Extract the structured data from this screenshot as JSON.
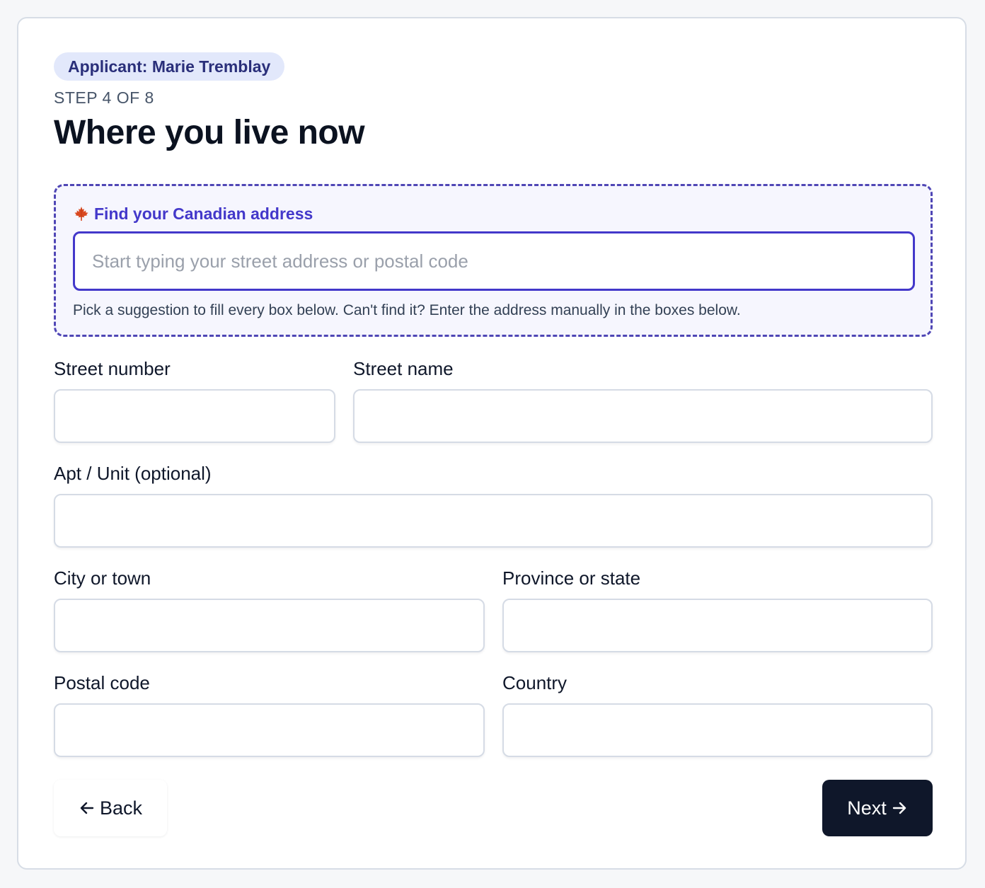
{
  "header": {
    "applicant_badge": "Applicant: Marie Tremblay",
    "step": "STEP 4 OF 8",
    "title": "Where you live now"
  },
  "lookup": {
    "heading": "Find your Canadian address",
    "icon": "maple-leaf-icon",
    "placeholder": "Start typing your street address or postal code",
    "value": "",
    "help": "Pick a suggestion to fill every box below. Can't find it? Enter the address manually in the boxes below."
  },
  "fields": {
    "street_number": {
      "label": "Street number",
      "value": ""
    },
    "street_name": {
      "label": "Street name",
      "value": ""
    },
    "apt_unit": {
      "label": "Apt / Unit (optional)",
      "value": ""
    },
    "city": {
      "label": "City or town",
      "value": ""
    },
    "province": {
      "label": "Province or state",
      "value": ""
    },
    "postal_code": {
      "label": "Postal code",
      "value": ""
    },
    "country": {
      "label": "Country",
      "value": ""
    }
  },
  "actions": {
    "back_label": "Back",
    "next_label": "Next"
  },
  "colors": {
    "accent": "#4338ca",
    "primary_button": "#0f172a",
    "badge_bg": "#e2e8fb",
    "badge_text": "#2a2f7a"
  }
}
